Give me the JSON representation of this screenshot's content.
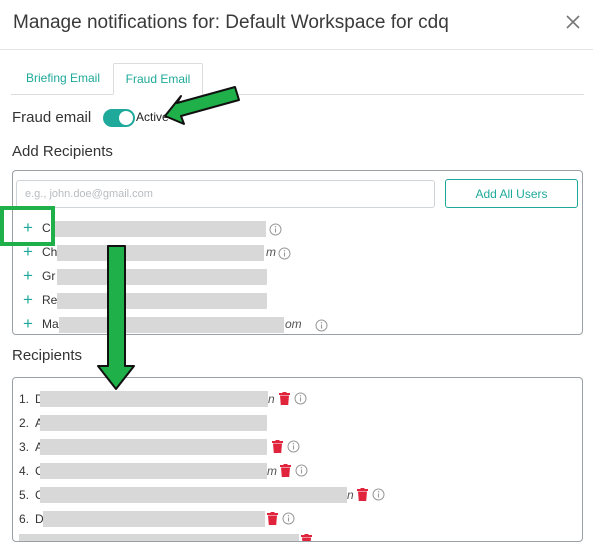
{
  "window": {
    "title": "Manage notifications for: Default Workspace for cdq"
  },
  "tabs": [
    {
      "label": "Briefing Email"
    },
    {
      "label": "Fraud Email"
    }
  ],
  "fraud": {
    "label": "Fraud email",
    "status": "Active",
    "enabled": true
  },
  "add_recipients": {
    "heading": "Add Recipients",
    "placeholder": "e.g., john.doe@gmail.com",
    "add_all_label": "Add All Users",
    "candidates": [
      {
        "initial": "C",
        "suffix": ""
      },
      {
        "initial": "Ch",
        "suffix": "m"
      },
      {
        "initial": "Gr",
        "suffix": ""
      },
      {
        "initial": "Re",
        "suffix": ""
      },
      {
        "initial": "Ma",
        "suffix": "om"
      }
    ]
  },
  "recipients": {
    "heading": "Recipients",
    "items": [
      {
        "num": "1.",
        "initial": "D",
        "suffix": "n"
      },
      {
        "num": "2.",
        "initial": "A",
        "suffix": ""
      },
      {
        "num": "3.",
        "initial": "A",
        "suffix": ""
      },
      {
        "num": "4.",
        "initial": "C",
        "suffix": "m"
      },
      {
        "num": "5.",
        "initial": "C",
        "suffix": "n"
      },
      {
        "num": "6.",
        "initial": "D",
        "suffix": ""
      }
    ]
  },
  "colors": {
    "accent": "#1fa99a",
    "annotation": "#1fb04a",
    "delete": "#e0243c",
    "redaction": "#d8d8d8"
  },
  "icons": {
    "close": "close-icon",
    "add": "plus-icon",
    "info": "info-icon",
    "delete": "trash-icon"
  }
}
